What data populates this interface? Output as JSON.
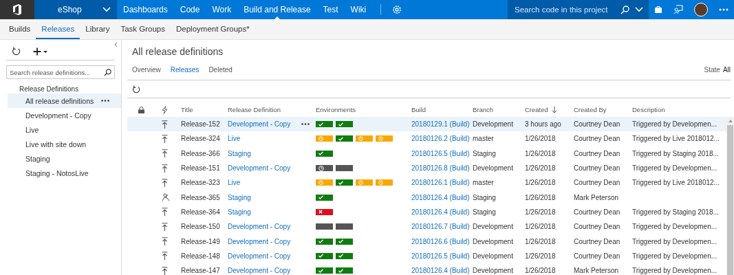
{
  "topbar": {
    "project": "eShop",
    "nav": [
      {
        "label": "Dashboards",
        "selected": false
      },
      {
        "label": "Code",
        "selected": false
      },
      {
        "label": "Work",
        "selected": false
      },
      {
        "label": "Build and Release",
        "selected": true
      },
      {
        "label": "Test",
        "selected": false
      },
      {
        "label": "Wiki",
        "selected": false
      }
    ],
    "search": {
      "placeholder": "Search code in this project"
    }
  },
  "subnav": [
    {
      "label": "Builds",
      "selected": false
    },
    {
      "label": "Releases",
      "selected": true
    },
    {
      "label": "Library",
      "selected": false
    },
    {
      "label": "Task Groups",
      "selected": false
    },
    {
      "label": "Deployment Groups*",
      "selected": false
    }
  ],
  "sidebar": {
    "search": {
      "placeholder": "Search release definitions..."
    },
    "heading": "Release Definitions",
    "items": [
      {
        "label": "All release definitions",
        "selected": true
      },
      {
        "label": "Development - Copy",
        "selected": false
      },
      {
        "label": "Live",
        "selected": false
      },
      {
        "label": "Live with site down",
        "selected": false
      },
      {
        "label": "Staging",
        "selected": false
      },
      {
        "label": "Staging - NotosLive",
        "selected": false
      }
    ]
  },
  "main": {
    "title": "All release definitions",
    "tabs": [
      {
        "label": "Overview",
        "selected": false
      },
      {
        "label": "Releases",
        "selected": true
      },
      {
        "label": "Deleted",
        "selected": false
      }
    ],
    "state_filter": {
      "label": "State",
      "value": "All"
    }
  },
  "table": {
    "columns": [
      "Title",
      "Release Definition",
      "Environments",
      "Build",
      "Branch",
      "Created",
      "Created By",
      "Description"
    ],
    "rows": [
      {
        "trigger": {
          "kind": "push"
        },
        "title": "Release-152",
        "definition": "Development - Copy",
        "environments": [
          {
            "kind": "succeeded"
          },
          {
            "kind": "succeeded"
          }
        ],
        "build": "20180129.1 (Build)",
        "branch": "Development",
        "created": "3 hours ago",
        "created_by": "Courtney Dean",
        "description": "Triggered by Developmen...",
        "selected": true
      },
      {
        "trigger": {
          "kind": "push"
        },
        "title": "Release-324",
        "definition": "Live",
        "environments": [
          {
            "kind": "pending"
          },
          {
            "kind": "succeeded"
          },
          {
            "kind": "pending"
          },
          {
            "kind": "pending"
          }
        ],
        "build": "20180126.2 (Build)",
        "branch": "master",
        "created": "1/26/2018",
        "created_by": "Courtney Dean",
        "description": "Triggered by Live 2018012...",
        "selected": false
      },
      {
        "trigger": {
          "kind": "push"
        },
        "title": "Release-366",
        "definition": "Staging",
        "environments": [
          {
            "kind": "succeeded"
          }
        ],
        "build": "20180126.5 (Build)",
        "branch": "Staging",
        "created": "1/26/2018",
        "created_by": "Courtney Dean",
        "description": "Triggered by Staging 2018...",
        "selected": false
      },
      {
        "trigger": {
          "kind": "push"
        },
        "title": "Release-151",
        "definition": "Development - Copy",
        "environments": [
          {
            "kind": "queued"
          },
          {
            "kind": "notdeployed"
          }
        ],
        "build": "20180126.8 (Build)",
        "branch": "Development",
        "created": "1/26/2018",
        "created_by": "Courtney Dean",
        "description": "Triggered by Developmen...",
        "selected": false
      },
      {
        "trigger": {
          "kind": "push"
        },
        "title": "Release-323",
        "definition": "Live",
        "environments": [
          {
            "kind": "pending"
          },
          {
            "kind": "succeeded"
          },
          {
            "kind": "pending"
          },
          {
            "kind": "pending"
          }
        ],
        "build": "20180126.1 (Build)",
        "branch": "master",
        "created": "1/26/2018",
        "created_by": "Courtney Dean",
        "description": "Triggered by Live 2018012...",
        "selected": false
      },
      {
        "trigger": {
          "kind": "manual"
        },
        "title": "Release-365",
        "definition": "Staging",
        "environments": [
          {
            "kind": "succeeded"
          }
        ],
        "build": "20180126.4 (Build)",
        "branch": "Staging",
        "created": "1/26/2018",
        "created_by": "Mark Peterson",
        "selected": false
      },
      {
        "trigger": {
          "kind": "push"
        },
        "title": "Release-364",
        "definition": "Staging",
        "environments": [
          {
            "kind": "failed"
          }
        ],
        "build": "20180126.4 (Build)",
        "branch": "Staging",
        "created": "1/26/2018",
        "created_by": "Courtney Dean",
        "description": "Triggered by Staging 2018...",
        "selected": false
      },
      {
        "trigger": {
          "kind": "push"
        },
        "title": "Release-150",
        "definition": "Development - Copy",
        "environments": [
          {
            "kind": "notdeployed"
          },
          {
            "kind": "notdeployed"
          }
        ],
        "build": "20180126.7 (Build)",
        "branch": "Development",
        "created": "1/26/2018",
        "created_by": "Courtney Dean",
        "description": "Triggered by Developmen...",
        "selected": false
      },
      {
        "trigger": {
          "kind": "push"
        },
        "title": "Release-149",
        "definition": "Development - Copy",
        "environments": [
          {
            "kind": "succeeded"
          },
          {
            "kind": "succeeded"
          }
        ],
        "build": "20180126.6 (Build)",
        "branch": "Development",
        "created": "1/26/2018",
        "created_by": "Courtney Dean",
        "description": "Triggered by Developmen...",
        "selected": false
      },
      {
        "trigger": {
          "kind": "push"
        },
        "title": "Release-148",
        "definition": "Development - Copy",
        "environments": [
          {
            "kind": "succeeded"
          },
          {
            "kind": "succeeded"
          }
        ],
        "build": "20180126.5 (Build)",
        "branch": "Development",
        "created": "1/26/2018",
        "created_by": "Courtney Dean",
        "description": "Triggered by Developmen...",
        "selected": false
      },
      {
        "trigger": {
          "kind": "push"
        },
        "title": "Release-147",
        "definition": "Development - Copy",
        "environments": [
          {
            "kind": "succeeded"
          },
          {
            "kind": "succeeded"
          }
        ],
        "build": "20180126.4 (Build)",
        "branch": "Development",
        "created": "1/26/2018",
        "created_by": "Mark Peterson",
        "description": "Triggered by Developmen...",
        "selected": false
      }
    ]
  }
}
